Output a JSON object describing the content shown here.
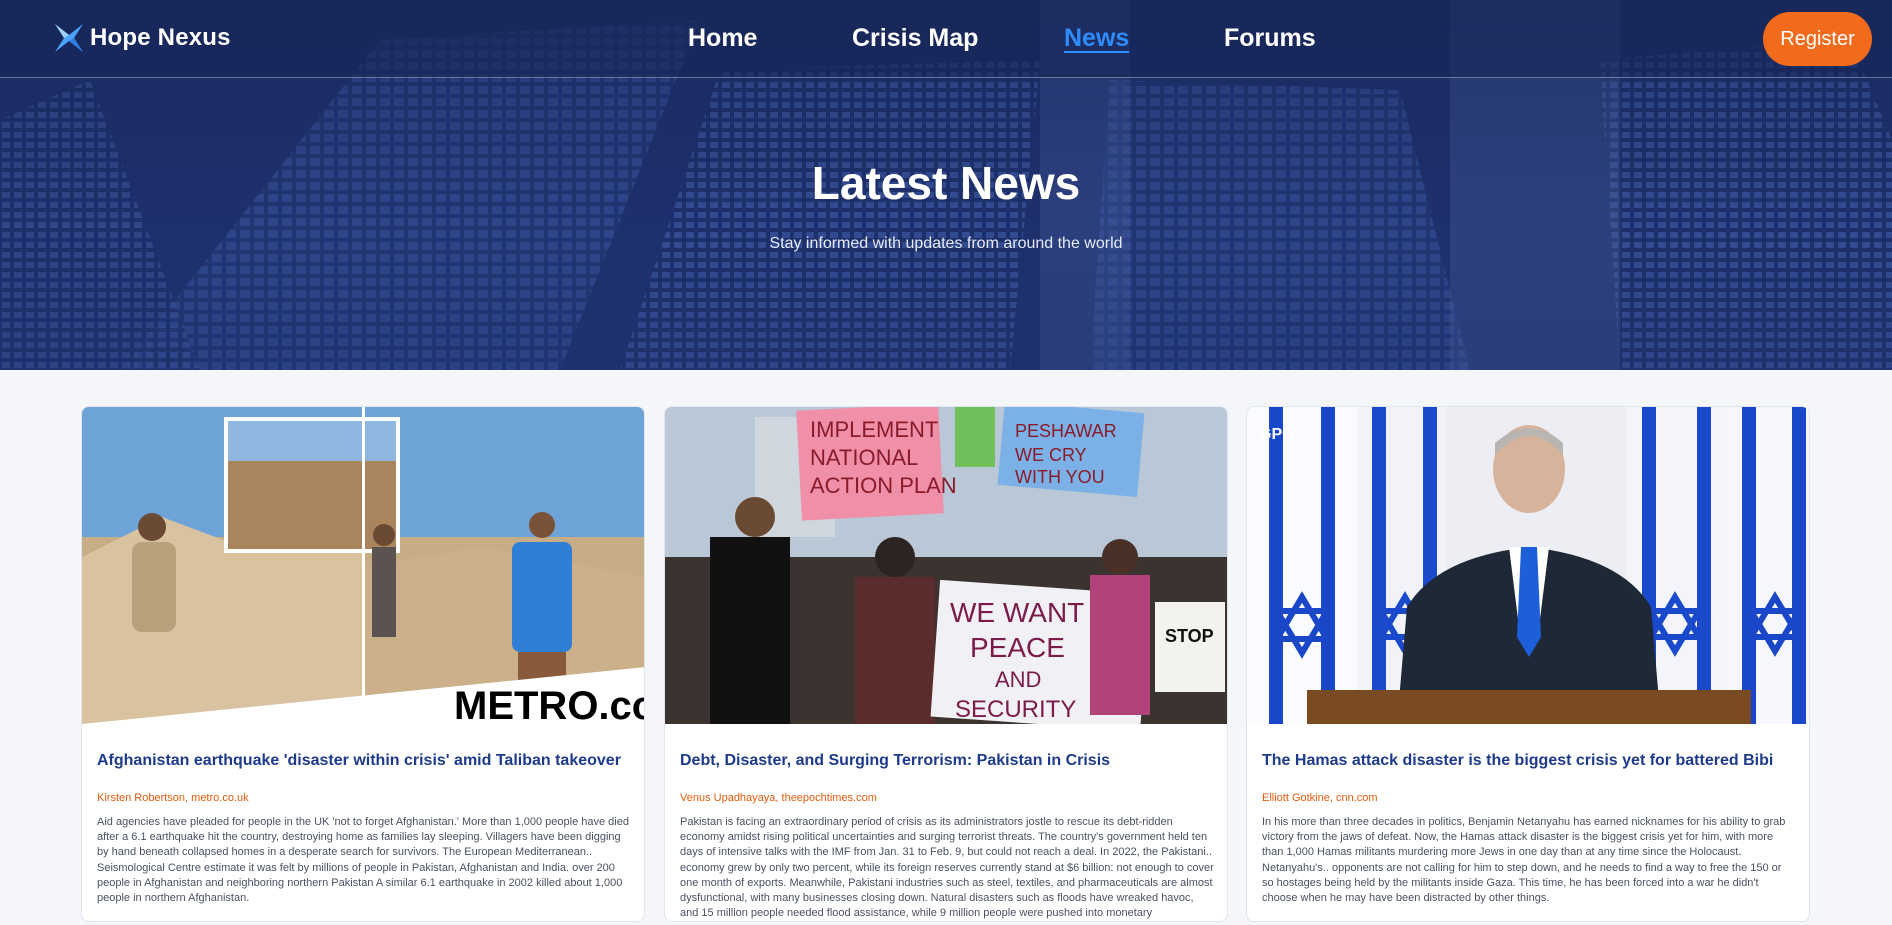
{
  "navbar": {
    "brand": "Hope Nexus",
    "links": [
      {
        "label": "Home",
        "active": false
      },
      {
        "label": "Crisis Map",
        "active": false
      },
      {
        "label": "News",
        "active": true
      },
      {
        "label": "Forums",
        "active": false
      }
    ],
    "register_label": "Register"
  },
  "hero": {
    "title": "Latest News",
    "subtitle": "Stay informed with updates from around the world"
  },
  "articles": [
    {
      "title": "Afghanistan earthquake 'disaster within crisis' amid Taliban takeover",
      "author": "Kirsten Robertson, metro.co.uk",
      "excerpt": "Aid agencies have pleaded for people in the UK 'not to forget Afghanistan.' More than 1,000 people have died after a 6.1 earthquake hit the country, destroying home as families lay sleeping. Villagers have been digging by hand beneath collapsed homes in a desperate search for survivors. The European Mediterranean.. Seismological Centre estimate it was felt by millions of people in Pakistan, Afghanistan and India. over 200 people in Afghanistan and neighboring northern Pakistan A similar 6.1 earthquake in 2002 killed about 1,000 people in northern Afghanistan.",
      "image_watermark": "METRO.co.uk"
    },
    {
      "title": "Debt, Disaster, and Surging Terrorism: Pakistan in Crisis",
      "author": "Venus Upadhayaya, theepochtimes.com",
      "excerpt": "Pakistan is facing an extraordinary period of crisis as its administrators jostle to rescue its debt-ridden economy amidst rising political uncertainties and surging terrorist threats. The country's government held ten days of intensive talks with the IMF from Jan. 31 to Feb. 9, but could not reach a deal. In 2022, the Pakistani.. economy grew by only two percent, while its foreign reserves currently stand at $6 billion: not enough to cover one month of exports. Meanwhile, Pakistani industries such as steel, textiles, and pharmaceuticals are almost dysfunctional, with many businesses closing down. Natural disasters such as floods have wreaked havoc, and 15 million people needed flood assistance, while 9 million people were pushed into monetary",
      "image_signs": [
        "IMPLEMENT NATIONAL ACTION PLAN",
        "PESHAWAR WE CRY WITH YOU",
        "WE WANT PEACE AND SECURITY",
        "STOP"
      ]
    },
    {
      "title": "The Hamas attack disaster is the biggest crisis yet for battered Bibi",
      "author": "Elliott Gotkine, cnn.com",
      "excerpt": "In his more than three decades in politics, Benjamin Netanyahu has earned nicknames for his ability to grab victory from the jaws of defeat. Now, the Hamas attack disaster is the biggest crisis yet for him, with more than 1,000 Hamas militants murdering more Jews in one day than at any time since the Holocaust. Netanyahu's.. opponents are not calling for him to step down, and he needs to find a way to free the 150 or so hostages being held by the militants inside Gaza. This time, he has been forced into a war he didn't choose when he may have been distracted by other things.",
      "image_watermark": "GPO"
    }
  ],
  "colors": {
    "accent": "#f26b1d",
    "active_link": "#2f8cff",
    "title_blue": "#1e3a8a",
    "author_orange": "#e25b0d"
  }
}
